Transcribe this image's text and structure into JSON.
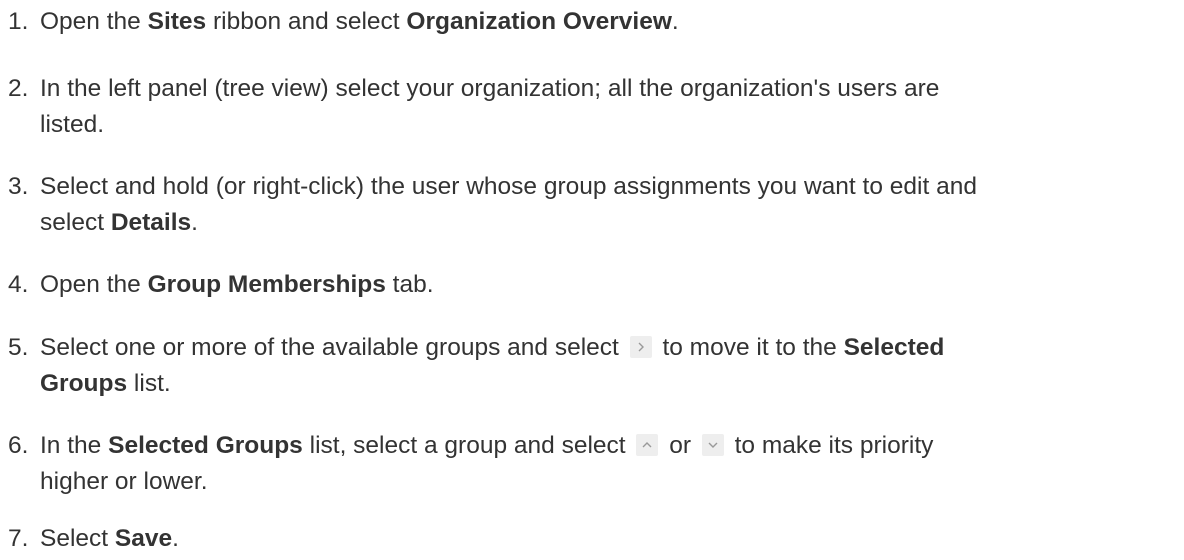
{
  "steps": [
    {
      "number": "1.",
      "parts": [
        "Open the ",
        "Sites",
        " ribbon and select ",
        "Organization Overview",
        "."
      ]
    },
    {
      "number": "2.",
      "line1": "In the left panel (tree view) select your organization; all the organization's users are",
      "line2": "listed."
    },
    {
      "number": "3.",
      "line1": "Select and hold (or right-click) the user whose group assignments you want to edit and",
      "line2_parts": [
        "select ",
        "Details",
        "."
      ]
    },
    {
      "number": "4.",
      "parts": [
        "Open the ",
        "Group Memberships",
        " tab."
      ]
    },
    {
      "number": "5.",
      "line1_parts": [
        "Select one or more of the available groups and select ",
        " to move it to the ",
        "Selected"
      ],
      "line2_parts": [
        "Groups",
        " list."
      ]
    },
    {
      "number": "6.",
      "line1_parts": [
        "In the ",
        "Selected Groups",
        " list, select a group and select ",
        " or ",
        " to make its priority"
      ],
      "line2": "higher or lower."
    },
    {
      "number": "7.",
      "parts": [
        "Select ",
        "Save",
        "."
      ]
    }
  ],
  "icons": {
    "move_right": "chevron-right-icon",
    "move_up": "chevron-up-icon",
    "move_down": "chevron-down-icon",
    "icon_color": "#999999",
    "icon_bg": "#eeeeee"
  }
}
